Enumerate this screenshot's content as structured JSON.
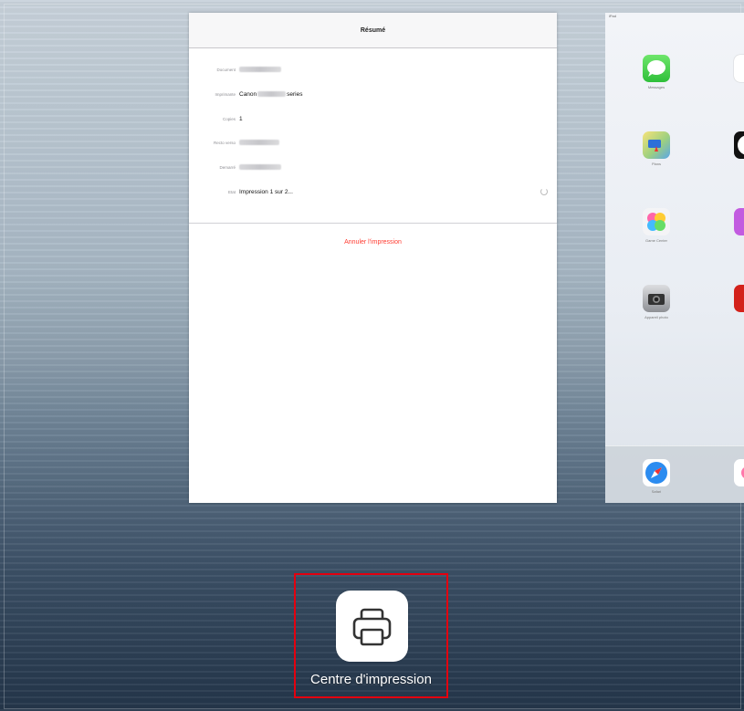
{
  "print_summary": {
    "title": "Résumé",
    "rows": [
      {
        "label": "Document",
        "value": ""
      },
      {
        "label": "Imprimante",
        "value_prefix": "Canon",
        "value_suffix": "series"
      },
      {
        "label": "Copies",
        "value": "1"
      },
      {
        "label": "Recto verso",
        "value": ""
      },
      {
        "label": "Demarré",
        "value": ""
      },
      {
        "label": "Etat",
        "value": "Impression 1 sur 2..."
      }
    ],
    "cancel_label": "Annuler l'impression"
  },
  "ipad": {
    "status_text": "iPad",
    "apps": [
      {
        "name": "Messages",
        "icon": "messages-icon"
      },
      {
        "name": "Plans",
        "icon": "maps-icon"
      },
      {
        "name": "Game Center",
        "icon": "game-center-icon"
      },
      {
        "name": "Appareil photo",
        "icon": "camera-icon"
      }
    ],
    "dock": [
      {
        "name": "Safari",
        "icon": "safari-icon"
      }
    ]
  },
  "print_center": {
    "label": "Centre d'impression",
    "icon": "printer-icon"
  },
  "colors": {
    "cancel": "#ff3b30",
    "highlight": "#e3000f"
  }
}
